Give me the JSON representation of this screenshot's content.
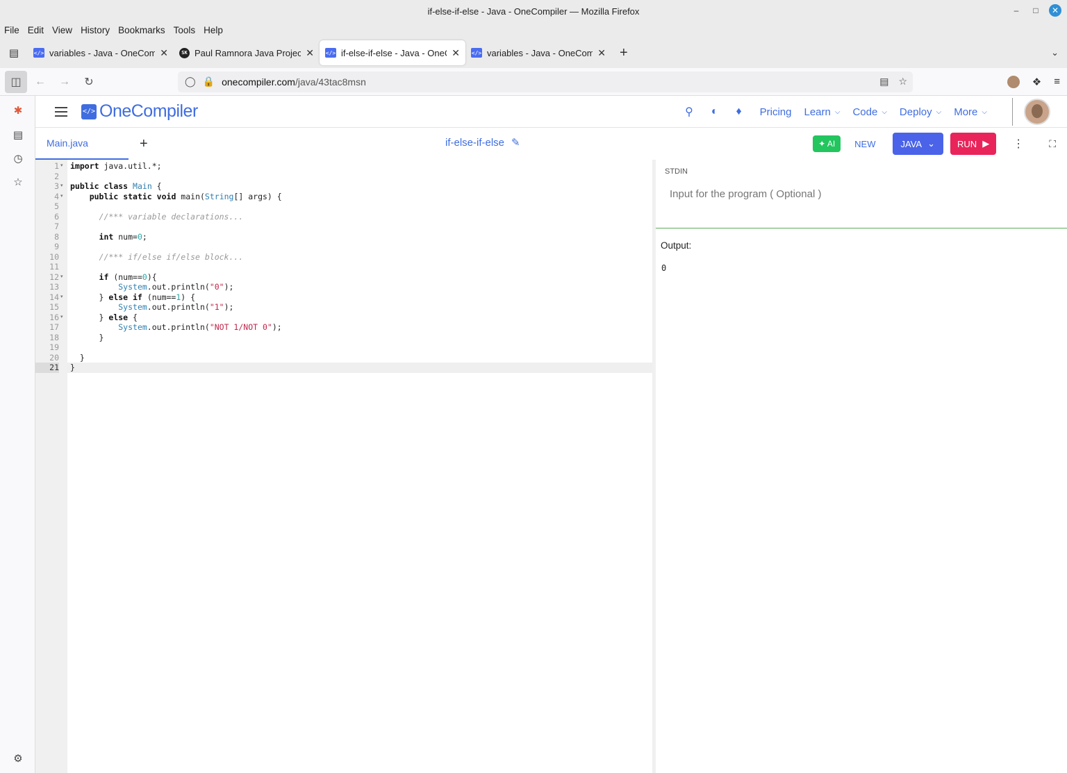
{
  "window": {
    "title": "if-else-if-else - Java - OneCompiler — Mozilla Firefox"
  },
  "menu": [
    "File",
    "Edit",
    "View",
    "History",
    "Bookmarks",
    "Tools",
    "Help"
  ],
  "tabs": [
    {
      "title": "variables - Java - OneCompi",
      "favicon": "onecompiler-icon",
      "active": false
    },
    {
      "title": "Paul Ramnora Java Project |",
      "favicon": "sk-icon",
      "active": false
    },
    {
      "title": "if-else-if-else - Java - OneCo",
      "favicon": "onecompiler-icon",
      "active": true
    },
    {
      "title": "variables - Java - OneCompi",
      "favicon": "onecompiler-icon",
      "active": false
    }
  ],
  "url": {
    "host": "onecompiler.com",
    "path": "/java/43tac8msn"
  },
  "app": {
    "brand": "OneCompiler",
    "nav": {
      "pricing": "Pricing",
      "learn": "Learn",
      "code": "Code",
      "deploy": "Deploy",
      "more": "More"
    }
  },
  "toolbar": {
    "file_tab": "Main.java",
    "project_name": "if-else-if-else",
    "ai_label": "AI",
    "new_label": "NEW",
    "language_label": "JAVA",
    "run_label": "RUN"
  },
  "editor": {
    "line_count": 21,
    "current_line": 21,
    "lines": [
      "import java.util.*;",
      "",
      "public class Main {",
      "    public static void main(String[] args) {",
      "",
      "      //*** variable declarations...",
      "",
      "      int num=0;",
      "",
      "      //*** if/else if/else block...",
      "",
      "      if (num==0){",
      "          System.out.println(\"0\");",
      "      } else if (num==1) {",
      "          System.out.println(\"1\");",
      "      } else {",
      "          System.out.println(\"NOT 1/NOT 0\");",
      "      }",
      "",
      "  }",
      "}"
    ]
  },
  "stdin": {
    "label": "STDIN",
    "placeholder": "Input for the program ( Optional )"
  },
  "output": {
    "label": "Output:",
    "value": "0"
  },
  "colors": {
    "brand": "#3f6de0",
    "run": "#e8245b",
    "java": "#4a63e8",
    "ai": "#22c55e",
    "stdin_border": "#5aae5a"
  }
}
